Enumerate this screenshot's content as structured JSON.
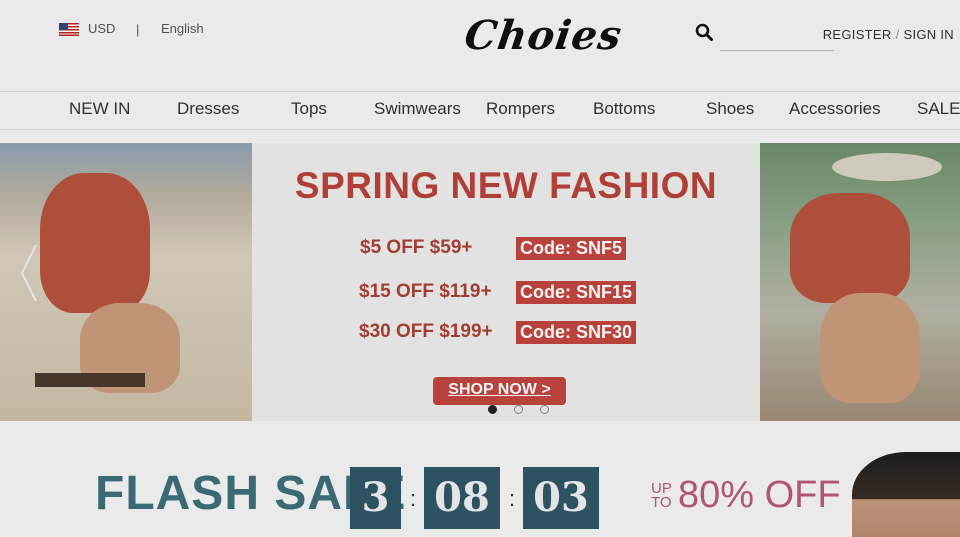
{
  "header": {
    "currency": "USD",
    "separator": "|",
    "language": "English",
    "logo": "Choies",
    "search_placeholder": "",
    "register": "REGISTER",
    "auth_separator": "/",
    "sign_in": "SIGN IN"
  },
  "nav": {
    "items": [
      {
        "label": "NEW IN"
      },
      {
        "label": "Dresses"
      },
      {
        "label": "Tops"
      },
      {
        "label": "Swimwears"
      },
      {
        "label": "Rompers"
      },
      {
        "label": "Bottoms"
      },
      {
        "label": "Shoes"
      },
      {
        "label": "Accessories"
      },
      {
        "label": "SALE"
      }
    ]
  },
  "banner": {
    "headline": "SPRING NEW FASHION",
    "offers": [
      {
        "text": "$5 OFF $59+",
        "code": "Code: SNF5"
      },
      {
        "text": "$15 OFF $119+",
        "code": "Code: SNF15"
      },
      {
        "text": "$30 OFF $199+",
        "code": "Code: SNF30"
      }
    ],
    "cta": "SHOP NOW >",
    "slides_total": 3,
    "active_slide": 1
  },
  "flash_sale": {
    "title": "FLASH SALE",
    "hours": "3",
    "minutes": "08",
    "seconds": "03",
    "colon": ":",
    "upto_line1": "UP",
    "upto_line2": "TO",
    "discount": "80% OFF"
  },
  "colors": {
    "brand_red": "#c1453f",
    "flash_teal": "#3d6f78",
    "countdown_bg": "#2f5665",
    "discount_pink": "#b85a7a"
  },
  "icons": {
    "flag": "us-flag-icon",
    "search": "search-icon",
    "prev": "chevron-left-icon"
  }
}
